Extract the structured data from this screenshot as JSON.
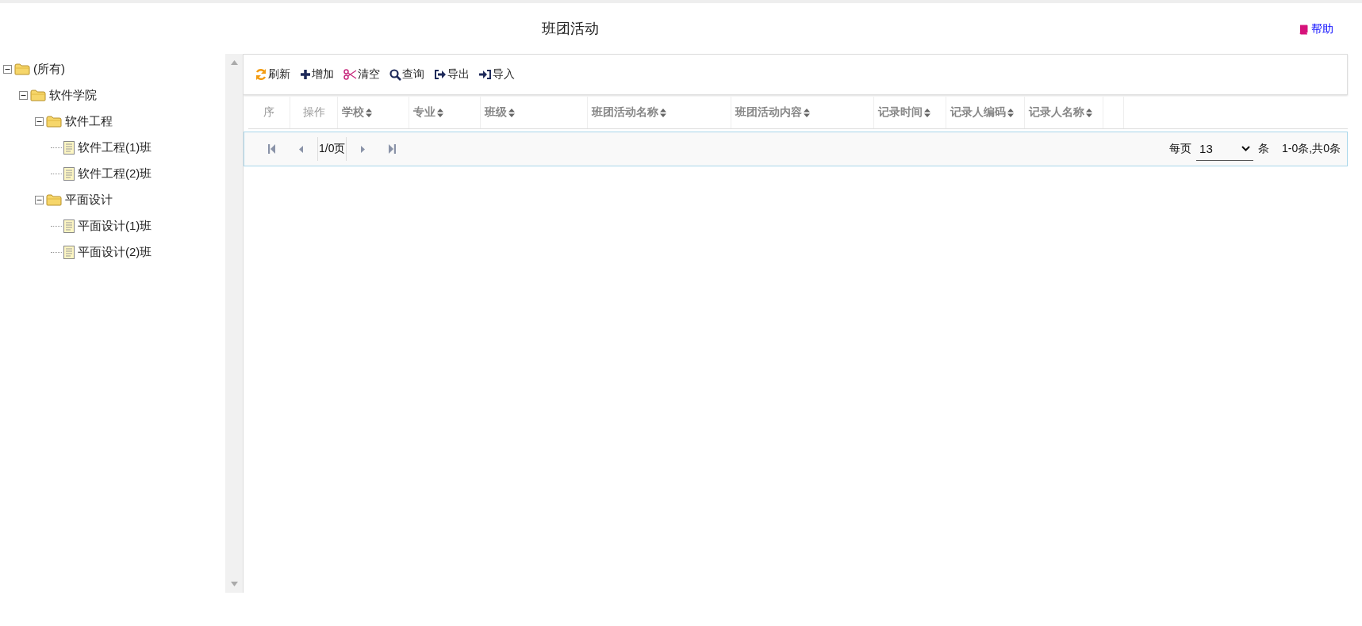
{
  "page_title": "班团活动",
  "help_link": "帮助",
  "tree": [
    {
      "label": "(所有)",
      "kind": "folder",
      "expanded": true,
      "children": [
        {
          "label": "软件学院",
          "kind": "folder",
          "expanded": true,
          "children": [
            {
              "label": "软件工程",
              "kind": "folder",
              "expanded": true,
              "children": [
                {
                  "label": "软件工程(1)班",
                  "kind": "file"
                },
                {
                  "label": "软件工程(2)班",
                  "kind": "file"
                }
              ]
            },
            {
              "label": "平面设计",
              "kind": "folder",
              "expanded": true,
              "children": [
                {
                  "label": "平面设计(1)班",
                  "kind": "file"
                },
                {
                  "label": "平面设计(2)班",
                  "kind": "file"
                }
              ]
            }
          ]
        }
      ]
    }
  ],
  "toolbar": [
    {
      "label": "刷新",
      "kind": "refresh"
    },
    {
      "label": "增加",
      "kind": "add"
    },
    {
      "label": "清空",
      "kind": "clear"
    },
    {
      "label": "查询",
      "kind": "search"
    },
    {
      "label": "导出",
      "kind": "export"
    },
    {
      "label": "导入",
      "kind": "import"
    }
  ],
  "table": {
    "columns": [
      {
        "label": "序",
        "sortable": false
      },
      {
        "label": "操作",
        "sortable": false
      },
      {
        "label": "学校",
        "sortable": true
      },
      {
        "label": "专业",
        "sortable": true
      },
      {
        "label": "班级",
        "sortable": true
      },
      {
        "label": "班团活动名称",
        "sortable": true
      },
      {
        "label": "班团活动内容",
        "sortable": true
      },
      {
        "label": "记录时间",
        "sortable": true
      },
      {
        "label": "记录人编码",
        "sortable": true
      },
      {
        "label": "记录人名称",
        "sortable": true
      }
    ]
  },
  "pager": {
    "page_text": "1/0页",
    "per_page_label": "每页",
    "per_page": "13",
    "per_page_unit": "条",
    "range_text": "1-0条,共0条"
  }
}
